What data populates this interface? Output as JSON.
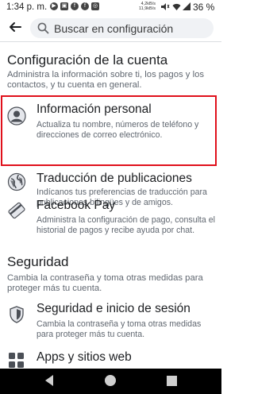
{
  "status_bar": {
    "time": "1:34 p. m.",
    "net_speed_up": "4,2kB/s",
    "net_speed_down": "11,9kB/s",
    "battery": "36 %"
  },
  "search": {
    "placeholder": "Buscar en configuración"
  },
  "account": {
    "title": "Configuración de la cuenta",
    "description": "Administra la información sobre ti, los pagos y los contactos, y tu cuenta en general.",
    "items": [
      {
        "label": "Información personal",
        "description": "Actualiza tu nombre, números de teléfono y direcciones de correo electrónico.",
        "icon": "user-icon"
      },
      {
        "label": "Traducción de publicaciones",
        "description": "Indícanos tus preferencias de traducción para publicaciones bilingües y de amigos.",
        "icon": "globe-icon"
      },
      {
        "label": "Facebook Pay",
        "description": "Administra la configuración de pago, consulta el historial de pagos y recibe ayuda por chat.",
        "icon": "card-icon"
      }
    ]
  },
  "security": {
    "title": "Seguridad",
    "description": "Cambia la contraseña y toma otras medidas para proteger más tu cuenta.",
    "items": [
      {
        "label": "Seguridad e inicio de sesión",
        "description": "Cambia la contraseña y toma otras medidas para proteger más tu cuenta.",
        "icon": "shield-icon"
      },
      {
        "label": "Apps y sitios web",
        "description": "",
        "icon": "apps-icon"
      }
    ]
  },
  "colors": {
    "highlight": "#e0101b",
    "text": "#1c1e21",
    "secondary_text": "#606770",
    "search_bg": "#f0f2f5"
  }
}
